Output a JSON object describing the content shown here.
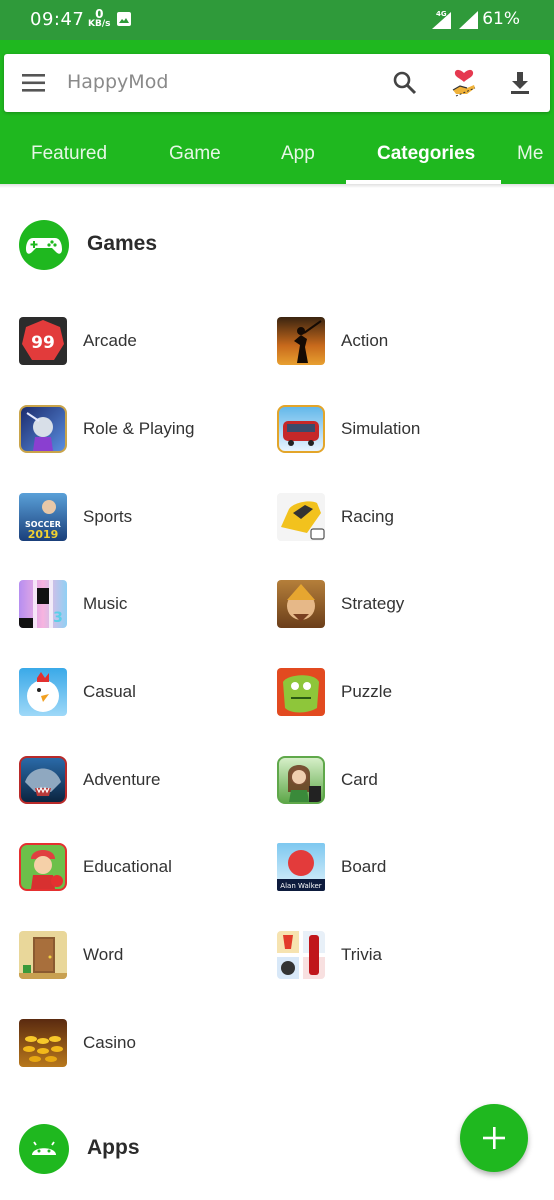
{
  "status_bar": {
    "time": "09:47",
    "net_speed": "0",
    "net_unit": "KB/s",
    "network": "4G",
    "battery": "61%"
  },
  "search": {
    "placeholder": "HappyMod"
  },
  "tabs": [
    {
      "label": "Featured",
      "active": false
    },
    {
      "label": "Game",
      "active": false
    },
    {
      "label": "App",
      "active": false
    },
    {
      "label": "Categories",
      "active": true
    },
    {
      "label": "Me",
      "active": false
    }
  ],
  "sections": {
    "games": {
      "title": "Games",
      "icon": "gamepad-icon"
    },
    "apps": {
      "title": "Apps",
      "icon": "android-icon"
    }
  },
  "categories": [
    {
      "label": "Arcade",
      "icon": "arcade-icon"
    },
    {
      "label": "Action",
      "icon": "action-icon"
    },
    {
      "label": "Role & Playing",
      "icon": "role-playing-icon"
    },
    {
      "label": "Simulation",
      "icon": "simulation-icon"
    },
    {
      "label": "Sports",
      "icon": "sports-icon"
    },
    {
      "label": "Racing",
      "icon": "racing-icon"
    },
    {
      "label": "Music",
      "icon": "music-icon"
    },
    {
      "label": "Strategy",
      "icon": "strategy-icon"
    },
    {
      "label": "Casual",
      "icon": "casual-icon"
    },
    {
      "label": "Puzzle",
      "icon": "puzzle-icon"
    },
    {
      "label": "Adventure",
      "icon": "adventure-icon"
    },
    {
      "label": "Card",
      "icon": "card-icon"
    },
    {
      "label": "Educational",
      "icon": "educational-icon"
    },
    {
      "label": "Board",
      "icon": "board-icon"
    },
    {
      "label": "Word",
      "icon": "word-icon"
    },
    {
      "label": "Trivia",
      "icon": "trivia-icon"
    },
    {
      "label": "Casino",
      "icon": "casino-icon"
    }
  ],
  "icon_texts": {
    "arcade": "99",
    "sports": "SOCCER",
    "sports_year": "2019",
    "board": "Alan Walker"
  },
  "colors": {
    "brand_green": "#1fb81f",
    "status_green": "#2f9a3a"
  }
}
